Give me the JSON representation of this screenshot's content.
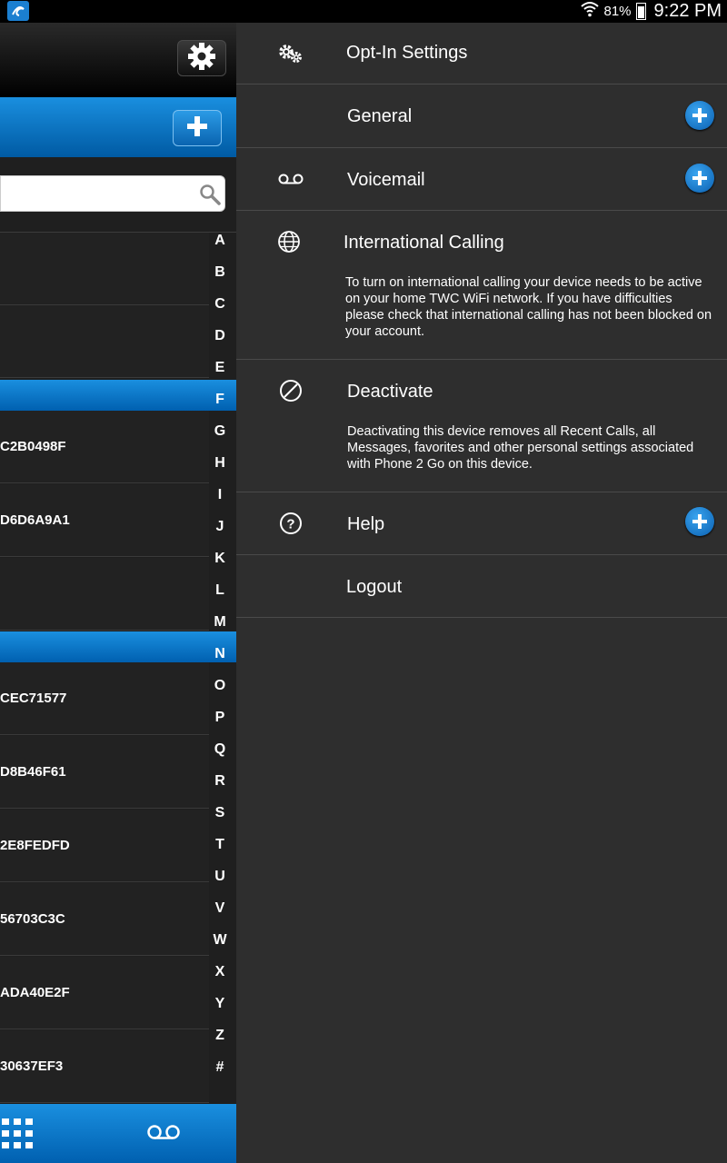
{
  "status_bar": {
    "battery": "81%",
    "time": "9:22 PM"
  },
  "contacts_pane": {
    "rows": [
      {
        "label": ""
      },
      {
        "label": ""
      },
      {
        "label": "C2B0498F"
      },
      {
        "label": "D6D6A9A1"
      },
      {
        "label": ""
      },
      {
        "label": "CEC71577"
      },
      {
        "label": "D8B46F61"
      },
      {
        "label": "2E8FEDFD"
      },
      {
        "label": "56703C3C"
      },
      {
        "label": "ADA40E2F"
      },
      {
        "label": "30637EF3"
      }
    ],
    "alphabet": [
      "A",
      "B",
      "C",
      "D",
      "E",
      "F",
      "G",
      "H",
      "I",
      "J",
      "K",
      "L",
      "M",
      "N",
      "O",
      "P",
      "Q",
      "R",
      "S",
      "T",
      "U",
      "V",
      "W",
      "X",
      "Y",
      "Z",
      "#"
    ]
  },
  "menu": {
    "opt_in": {
      "label": "Opt-In Settings"
    },
    "general": {
      "label": "General"
    },
    "voicemail": {
      "label": "Voicemail"
    },
    "international": {
      "label": "International Calling",
      "description": "To turn on international calling your device needs to be active on your home TWC WiFi network. If you have difficulties please check that international calling has not been blocked on your account."
    },
    "deactivate": {
      "label": "Deactivate",
      "description": "Deactivating this device removes all Recent Calls, all Messages, favorites and other personal settings associated with Phone 2 Go on this device."
    },
    "help": {
      "label": "Help"
    },
    "logout": {
      "label": "Logout"
    }
  },
  "colors": {
    "accent_blue": "#0a78c8",
    "menu_bg": "#2e2e2e",
    "pane_bg": "#1f1f1f"
  }
}
